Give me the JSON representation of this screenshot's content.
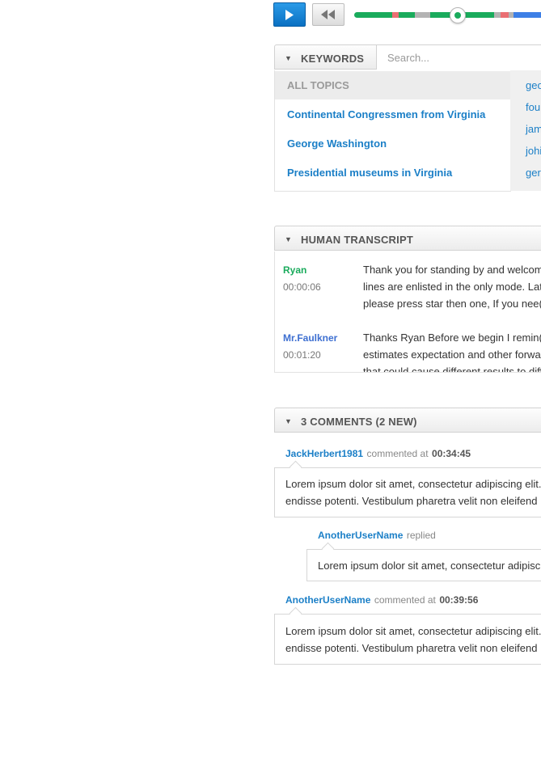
{
  "player": {
    "play_icon": "play-icon",
    "rewind_icon": "rewind-icon",
    "progress": 0.55,
    "colors": {
      "green": "#1aab5c",
      "red": "#ea6f73",
      "gray": "#b3b3b3",
      "blue": "#3d7fe6"
    }
  },
  "keywords": {
    "header": "KEYWORDS",
    "search_placeholder": "Search...",
    "all_topics": "ALL TOPICS",
    "topics": [
      "Continental Congressmen from Virginia",
      "George Washington",
      "Presidential museums in Virginia"
    ],
    "terms": [
      "geo",
      "fou",
      "jam",
      "johi",
      "ger"
    ]
  },
  "transcript": {
    "header": "HUMAN TRANSCRIPT",
    "entries": [
      {
        "speaker": "Ryan",
        "time": "00:00:06",
        "lines": [
          "Thank you for standing by and welcom",
          "lines are enlisted in the only mode. Lat",
          "please press star then one, If you nee("
        ]
      },
      {
        "speaker": "Mr.Faulkner",
        "time": "00:01:20",
        "lines": [
          "Thanks Ryan Before we begin I remin(",
          "estimates expectation and other forwa",
          "that could cause different results to diff"
        ]
      }
    ],
    "colors": {
      "ryan": "#1aab5c",
      "faulkner": "#3d6fd1"
    }
  },
  "comments": {
    "header": "3 COMMENTS (2 NEW)",
    "items": [
      {
        "user": "JackHerbert1981",
        "action": "commented at",
        "time": "00:34:45",
        "lines": [
          "Lorem ipsum dolor sit amet, consectetur adipiscing elit.",
          "endisse potenti. Vestibulum pharetra velit non eleifend"
        ]
      },
      {
        "user": "AnotherUserName",
        "action": "replied",
        "lines": [
          "Lorem ipsum dolor sit amet, consectetur adipisc"
        ]
      },
      {
        "user": "AnotherUserName",
        "action": "commented at",
        "time": "00:39:56",
        "lines": [
          "Lorem ipsum dolor sit amet, consectetur adipiscing elit.",
          "endisse potenti. Vestibulum pharetra velit non eleifend"
        ]
      }
    ]
  }
}
